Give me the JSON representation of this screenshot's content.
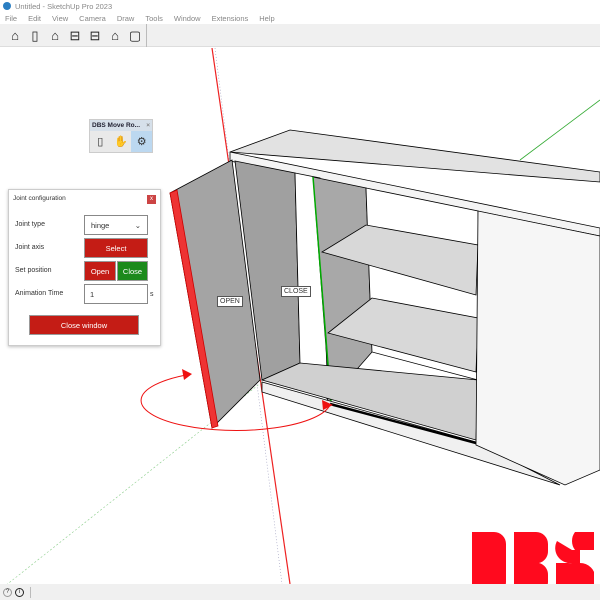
{
  "window": {
    "title": "Untitled - SketchUp Pro 2023"
  },
  "menu": [
    "File",
    "Edit",
    "View",
    "Camera",
    "Draw",
    "Tools",
    "Window",
    "Extensions",
    "Help"
  ],
  "toolbar_icons": [
    "iso-view-icon",
    "door-icon",
    "front-view-icon",
    "top-view-icon",
    "side-view-icon",
    "home-icon",
    "back-view-icon"
  ],
  "dbs_toolbar": {
    "title": "DBS Move Ro...",
    "close": "×",
    "icons": [
      "door-icon",
      "hand-icon",
      "gear-icon"
    ]
  },
  "joint_config": {
    "title": "Joint configuration",
    "close": "x",
    "joint_type_label": "Joint type",
    "joint_type_value": "hinge",
    "joint_axis_label": "Joint axis",
    "select_label": "Select",
    "set_position_label": "Set position",
    "open_label": "Open",
    "close_label": "Close",
    "animation_time_label": "Animation Time",
    "animation_time_value": "1",
    "animation_unit": "s",
    "close_window_label": "Close window"
  },
  "scene_labels": {
    "open": "OPEN",
    "close": "CLOSE"
  },
  "logo": {
    "text": "DBS",
    "color": "#ff0a1e"
  },
  "colors": {
    "accent_red": "#c41c15",
    "accent_green": "#1c8a1c"
  }
}
